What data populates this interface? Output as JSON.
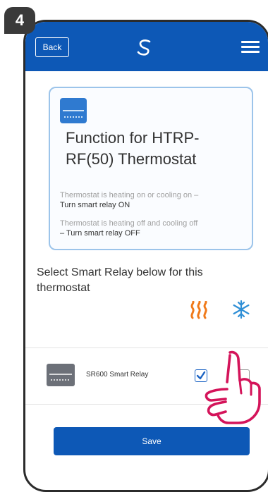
{
  "step": {
    "number": "4"
  },
  "header": {
    "back_label": "Back",
    "logo_icon": "salus-logo-icon",
    "menu_icon": "hamburger-menu-icon",
    "color": "#0d58b6"
  },
  "info_card": {
    "icon": "thermostat-device-icon",
    "title": "Function for HTRP-RF(50) Thermostat",
    "note1_grey": "Thermostat is heating on or cooling on –",
    "note1_dark": "Turn smart relay ON",
    "note2_grey": "Thermostat is heating off and cooling off",
    "note2_dark": "– Turn smart relay OFF"
  },
  "select_prompt": "Select Smart Relay below for this thermostat",
  "columns": [
    {
      "icon": "heating-icon",
      "color": "#f07a1a"
    },
    {
      "icon": "snowflake-icon",
      "color": "#2f8fd6"
    }
  ],
  "relays": [
    {
      "name": "SR600 Smart Relay",
      "icon": "smart-relay-device-icon",
      "heating_checked": true,
      "cooling_checked": false
    }
  ],
  "save_label": "Save",
  "overlay": {
    "icon": "pointing-hand-icon",
    "color": "#d4145a"
  }
}
